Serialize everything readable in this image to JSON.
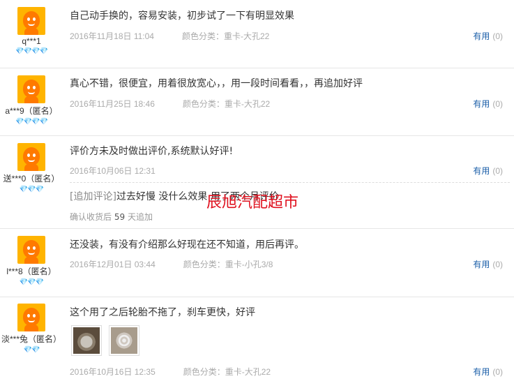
{
  "reviews": [
    {
      "username": "q***1",
      "rating_hearts": "💎💎💎💎",
      "content": "自己动手换的，容易安装，初步试了一下有明显效果",
      "date": "2016年11月18日 11:04",
      "sku": "颜色分类：重卡-大孔22",
      "useful_label": "有用",
      "useful_count": "(0)"
    },
    {
      "username": "a***9（匿名）",
      "rating_hearts": "💎💎💎💎",
      "content": "真心不错，很便宜，用着很放宽心，，用一段时间看看，，再追加好评",
      "date": "2016年11月25日 18:46",
      "sku": "颜色分类：重卡-大孔22",
      "useful_label": "有用",
      "useful_count": "(0)"
    },
    {
      "username": "送***0（匿名）",
      "rating_hearts": "💎💎💎",
      "content": "评价方未及时做出评价,系统默认好评!",
      "date": "2016年10月06日 12:31",
      "sku": "",
      "useful_label": "有用",
      "useful_count": "(0)",
      "followup": {
        "tag": "[追加评论]",
        "text": "过去好慢 没什么效果 用了两个月评价",
        "meta_prefix": "确认收货后",
        "days": "59",
        "meta_suffix": "天追加"
      }
    },
    {
      "username": "l***8（匿名）",
      "rating_hearts": "💎💎💎",
      "content": "还没装，有没有介绍那么好现在还不知道，用后再评。",
      "date": "2016年12月01日 03:44",
      "sku": "颜色分类：重卡-小孔3/8",
      "useful_label": "有用",
      "useful_count": "(0)"
    },
    {
      "username": "淡***兔（匿名）",
      "rating_hearts": "💎💎",
      "content": "这个用了之后轮胎不拖了，刹车更快，好评",
      "date": "2016年10月16日 12:35",
      "sku": "颜色分类：重卡-大孔22",
      "useful_label": "有用",
      "useful_count": "(0)"
    }
  ],
  "watermark": "辰旭汽配超市",
  "colors": {
    "link": "#1a5ea8",
    "meta": "#aaaaaa",
    "watermark": "#e0111f",
    "divider": "#e6e6e6"
  },
  "icons": {
    "avatar": "taobao-default-avatar-icon",
    "rating": "heart-rating-icon"
  }
}
